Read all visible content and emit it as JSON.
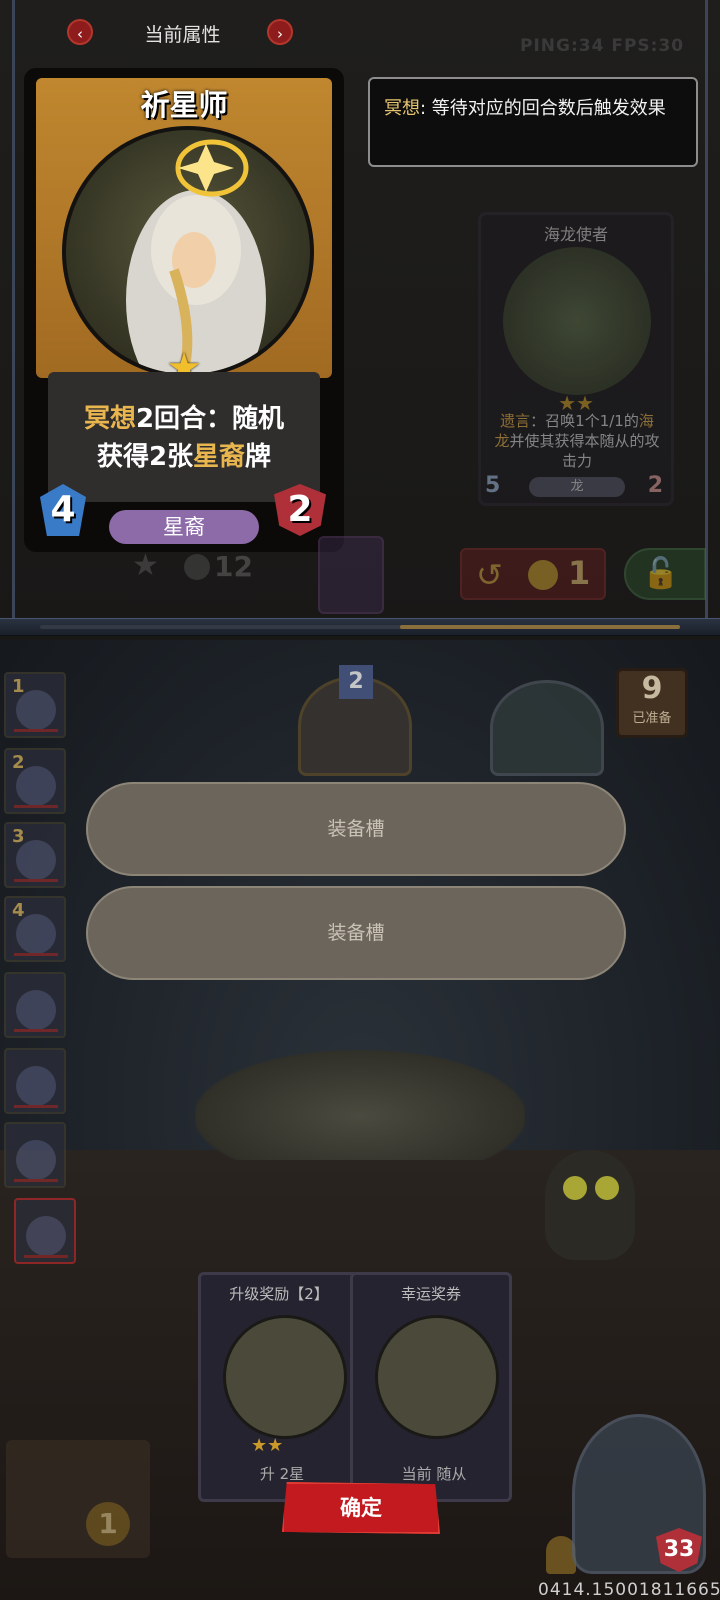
{
  "attributes_panel": {
    "title": "当前属性",
    "prev_arrow": "‹",
    "next_arrow": "›"
  },
  "status": {
    "ping_fps": "PING:34   FPS:30"
  },
  "tooltip": {
    "keyword": "冥想",
    "text": ": 等待对应的回合数后触发效果"
  },
  "main_card": {
    "name": "祈星师",
    "star": "★",
    "desc_kw1": "冥想",
    "desc_part1": "2回合：随机",
    "desc_part2": "获得2张",
    "desc_kw2": "星裔",
    "desc_part3": "牌",
    "tribe": "星裔",
    "attack": "4",
    "health": "2"
  },
  "side_card": {
    "name": "海龙使者",
    "stars": "★★",
    "desc_kw1": "遗言",
    "desc_part1": "：召唤1个1/1的",
    "desc_kw2": "海龙",
    "desc_part2": "并使其获得本随从的攻击力",
    "tribe": "龙",
    "attack": "5",
    "health": "2"
  },
  "shop": {
    "upgrade_cost": "12",
    "refresh_cost": "1"
  },
  "roster": [
    {
      "num": "1"
    },
    {
      "num": "2"
    },
    {
      "num": "3"
    },
    {
      "num": "4"
    },
    {
      "num": ""
    },
    {
      "num": ""
    },
    {
      "num": ""
    },
    {
      "num": ""
    }
  ],
  "board": {
    "minion_tier": "2",
    "ready_count": "9",
    "ready_label": "已准备"
  },
  "equip_slots": [
    "装备槽",
    "装备槽"
  ],
  "rewards": {
    "upgrade_title": "升级奖励【2】",
    "upgrade_stars": "★★",
    "upgrade_foot": "升 2星",
    "lucky_title": "幸运奖券",
    "lucky_foot": "当前 随从"
  },
  "confirm_label": "确定",
  "hero": {
    "gold": "1",
    "health": "33"
  },
  "build_id": "0414.15001811665",
  "colors": {
    "keyword": "#e9b54f",
    "confirm": "#c21a1e",
    "tribe_star": "#8d6ba8"
  }
}
